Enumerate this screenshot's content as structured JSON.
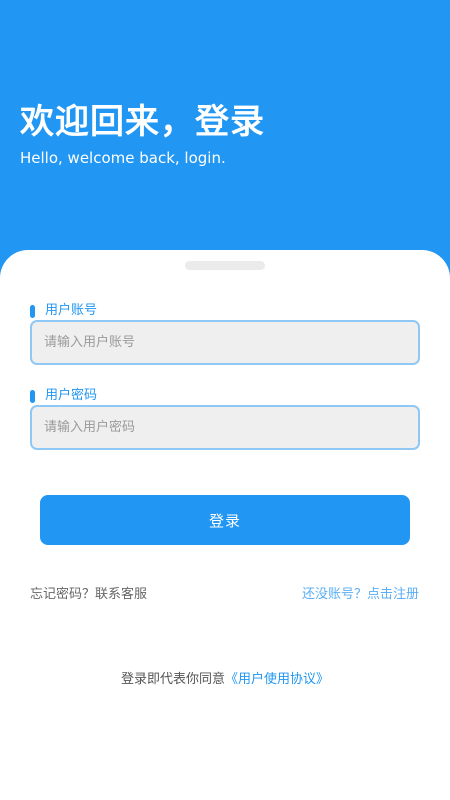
{
  "header": {
    "title": "欢迎回来，登录",
    "subtitle": "Hello, welcome back, login."
  },
  "form": {
    "account_label": "用户账号",
    "account_placeholder": "请输入用户账号",
    "password_label": "用户密码",
    "password_placeholder": "请输入用户密码",
    "login_label": "登录"
  },
  "links": {
    "forgot": "忘记密码？联系客服",
    "register": "还没账号？点击注册"
  },
  "agreement": {
    "prefix": "登录即代表你同意",
    "link": "《用户使用协议》"
  },
  "colors": {
    "primary": "#2196f3",
    "input_border": "#90c8f5",
    "input_bg": "#efefef"
  }
}
